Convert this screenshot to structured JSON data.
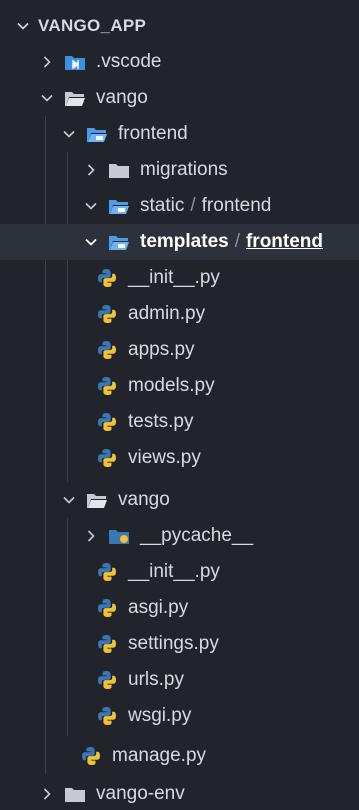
{
  "explorer": {
    "root": "VANGO_APP",
    "items": [
      {
        "label": "vscode",
        "prefix": ".",
        "depth": 1,
        "type": "folder",
        "expanded": false,
        "icon": "vscode-folder-icon"
      },
      {
        "label": "vango",
        "depth": 1,
        "type": "folder",
        "expanded": true,
        "icon": "folder-open-icon"
      },
      {
        "label": "frontend",
        "depth": 2,
        "type": "folder",
        "expanded": true,
        "icon": "special-folder-open-icon"
      },
      {
        "label": "migrations",
        "depth": 3,
        "type": "folder",
        "expanded": false,
        "icon": "folder-icon"
      },
      {
        "label": "static",
        "sub": "frontend",
        "depth": 3,
        "type": "folder",
        "expanded": true,
        "icon": "special-folder-open-icon"
      },
      {
        "label": "templates",
        "sub": "frontend",
        "depth": 3,
        "type": "folder",
        "expanded": true,
        "icon": "special-folder-open-icon",
        "selected": true
      },
      {
        "label": "__init__.py",
        "depth": 3,
        "type": "file",
        "icon": "python-icon"
      },
      {
        "label": "admin.py",
        "depth": 3,
        "type": "file",
        "icon": "python-icon"
      },
      {
        "label": "apps.py",
        "depth": 3,
        "type": "file",
        "icon": "python-icon"
      },
      {
        "label": "models.py",
        "depth": 3,
        "type": "file",
        "icon": "python-icon"
      },
      {
        "label": "tests.py",
        "depth": 3,
        "type": "file",
        "icon": "python-icon"
      },
      {
        "label": "views.py",
        "depth": 3,
        "type": "file",
        "icon": "python-icon"
      },
      {
        "label": "vango",
        "depth": 2,
        "type": "folder",
        "expanded": true,
        "icon": "folder-open-icon"
      },
      {
        "label": "__pycache__",
        "depth": 3,
        "type": "folder",
        "expanded": false,
        "icon": "pycache-folder-icon"
      },
      {
        "label": "__init__.py",
        "depth": 3,
        "type": "file",
        "icon": "python-icon"
      },
      {
        "label": "asgi.py",
        "depth": 3,
        "type": "file",
        "icon": "python-icon"
      },
      {
        "label": "settings.py",
        "depth": 3,
        "type": "file",
        "icon": "python-icon"
      },
      {
        "label": "urls.py",
        "depth": 3,
        "type": "file",
        "icon": "python-icon"
      },
      {
        "label": "wsgi.py",
        "depth": 3,
        "type": "file",
        "icon": "python-icon"
      },
      {
        "label": "manage.py",
        "depth": 2,
        "type": "file",
        "icon": "python-icon"
      },
      {
        "label": "vango-env",
        "depth": 1,
        "type": "folder",
        "expanded": false,
        "icon": "folder-icon"
      }
    ],
    "sep": "/"
  },
  "colors": {
    "background": "#21252b",
    "selected": "#2c313c",
    "text": "#d7dae0",
    "folder": "#c5cad3",
    "special_folder": "#4e9be6",
    "python_blue": "#3b77b5",
    "python_yellow": "#f1c232"
  }
}
